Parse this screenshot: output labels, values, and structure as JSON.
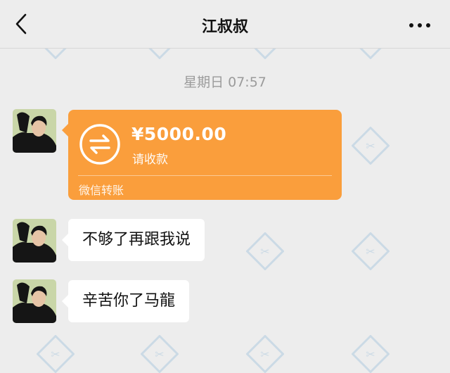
{
  "header": {
    "title": "江叔叔",
    "back_icon": "chevron-left-icon",
    "more_icon": "more-horizontal-icon"
  },
  "messages": {
    "timestamp": "星期日 07:57",
    "transfer": {
      "amount": "¥5000.00",
      "status": "请收款",
      "footer": "微信转账",
      "icon": "transfer-arrows-icon",
      "color": "#fa9e3c"
    },
    "texts": [
      "不够了再跟我说",
      "辛苦你了马龍"
    ]
  }
}
